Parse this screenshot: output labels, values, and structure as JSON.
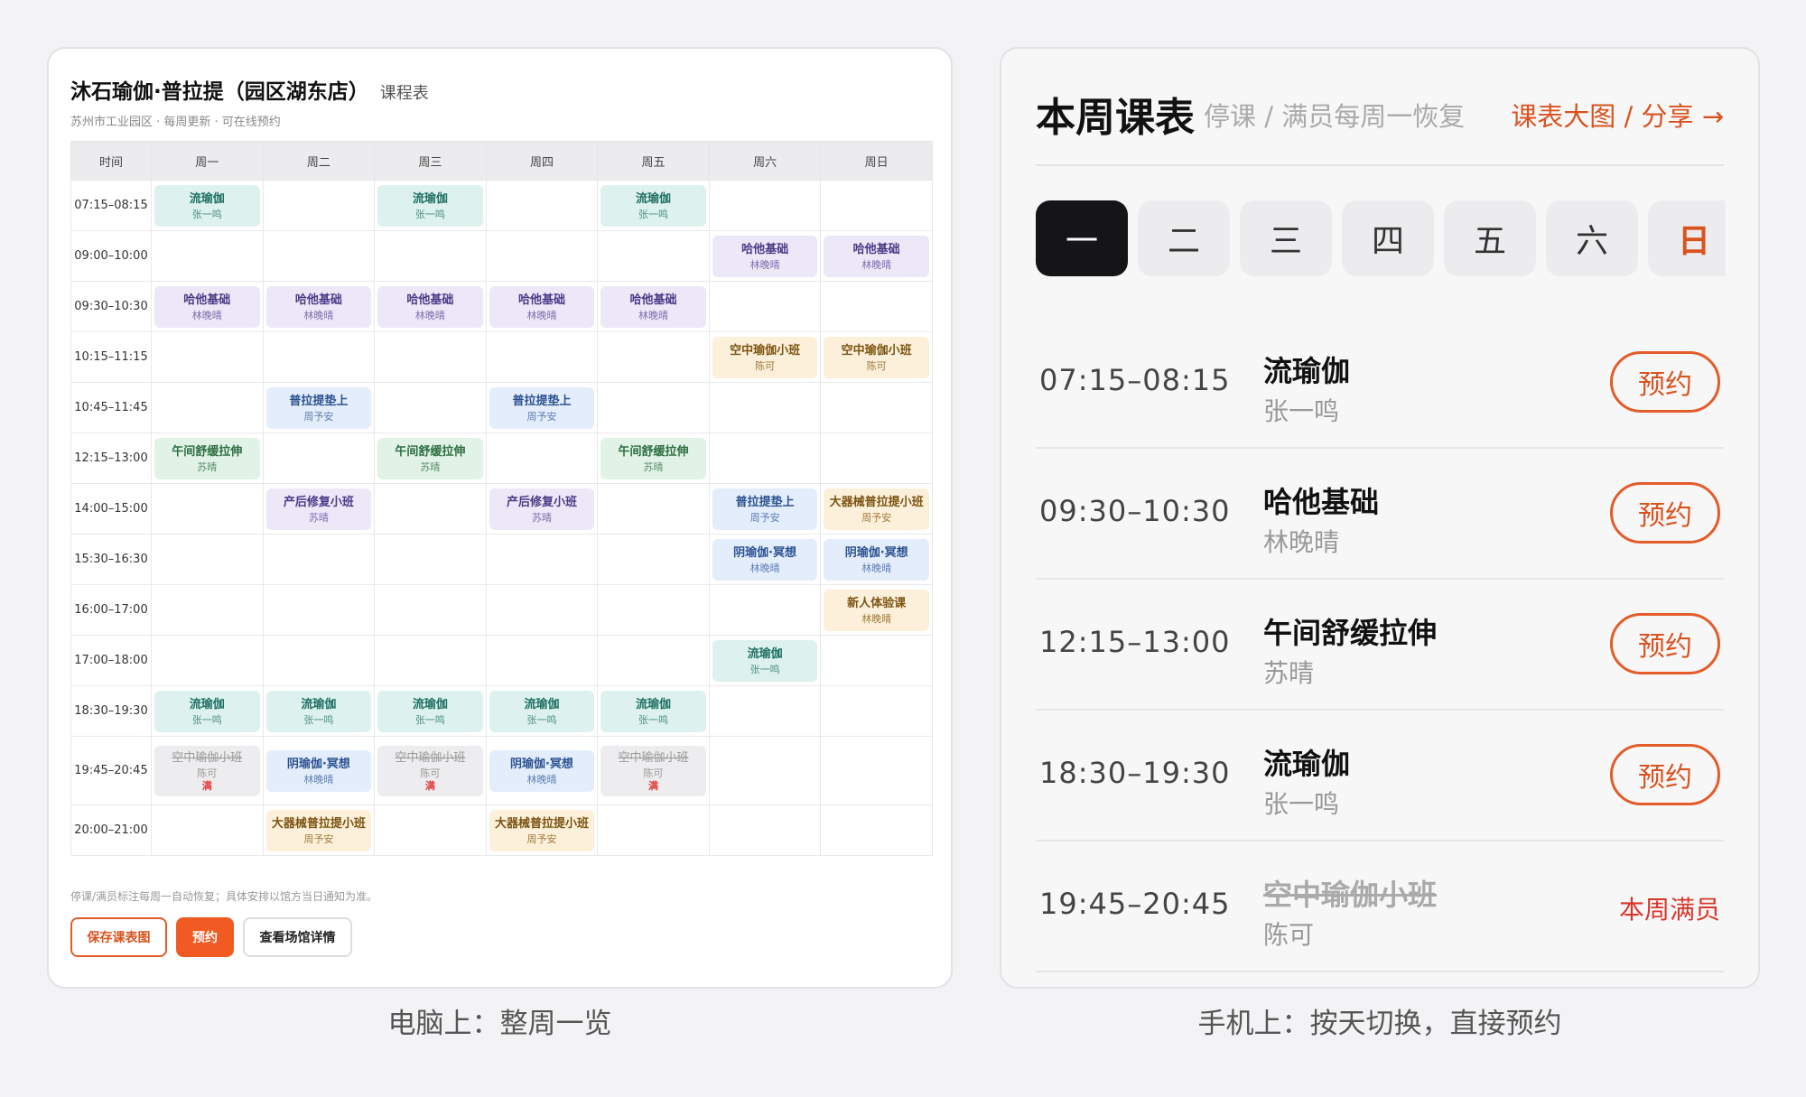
{
  "desktop": {
    "title": "沐石瑜伽·普拉提（园区湖东店）",
    "title_suffix": "课程表",
    "subtitle": "苏州市工业园区 · 每周更新 · 可在线预约",
    "headers": [
      "时间",
      "周一",
      "周二",
      "周三",
      "周四",
      "周五",
      "周六",
      "周日"
    ],
    "rows": [
      {
        "time": "07:15–08:15",
        "cells": [
          {
            "name": "流瑜伽",
            "teacher": "张一鸣",
            "color": "teal"
          },
          null,
          {
            "name": "流瑜伽",
            "teacher": "张一鸣",
            "color": "teal"
          },
          null,
          {
            "name": "流瑜伽",
            "teacher": "张一鸣",
            "color": "teal"
          },
          null,
          null
        ]
      },
      {
        "time": "09:00–10:00",
        "cells": [
          null,
          null,
          null,
          null,
          null,
          {
            "name": "哈他基础",
            "teacher": "林晚晴",
            "color": "lav"
          },
          {
            "name": "哈他基础",
            "teacher": "林晚晴",
            "color": "lav"
          }
        ]
      },
      {
        "time": "09:30–10:30",
        "cells": [
          {
            "name": "哈他基础",
            "teacher": "林晚晴",
            "color": "lav"
          },
          {
            "name": "哈他基础",
            "teacher": "林晚晴",
            "color": "lav"
          },
          {
            "name": "哈他基础",
            "teacher": "林晚晴",
            "color": "lav"
          },
          {
            "name": "哈他基础",
            "teacher": "林晚晴",
            "color": "lav"
          },
          {
            "name": "哈他基础",
            "teacher": "林晚晴",
            "color": "lav"
          },
          null,
          null
        ]
      },
      {
        "time": "10:15–11:15",
        "cells": [
          null,
          null,
          null,
          null,
          null,
          {
            "name": "空中瑜伽小班",
            "teacher": "陈可",
            "color": "amber"
          },
          {
            "name": "空中瑜伽小班",
            "teacher": "陈可",
            "color": "amber"
          }
        ]
      },
      {
        "time": "10:45–11:45",
        "cells": [
          null,
          {
            "name": "普拉提垫上",
            "teacher": "周予安",
            "color": "blue"
          },
          null,
          {
            "name": "普拉提垫上",
            "teacher": "周予安",
            "color": "blue"
          },
          null,
          null,
          null
        ]
      },
      {
        "time": "12:15–13:00",
        "cells": [
          {
            "name": "午间舒缓拉伸",
            "teacher": "苏晴",
            "color": "green"
          },
          null,
          {
            "name": "午间舒缓拉伸",
            "teacher": "苏晴",
            "color": "green"
          },
          null,
          {
            "name": "午间舒缓拉伸",
            "teacher": "苏晴",
            "color": "green"
          },
          null,
          null
        ]
      },
      {
        "time": "14:00–15:00",
        "cells": [
          null,
          {
            "name": "产后修复小班",
            "teacher": "苏晴",
            "color": "lav"
          },
          null,
          {
            "name": "产后修复小班",
            "teacher": "苏晴",
            "color": "lav"
          },
          null,
          {
            "name": "普拉提垫上",
            "teacher": "周予安",
            "color": "blue"
          },
          {
            "name": "大器械普拉提小班",
            "teacher": "周予安",
            "color": "amber"
          }
        ]
      },
      {
        "time": "15:30–16:30",
        "cells": [
          null,
          null,
          null,
          null,
          null,
          {
            "name": "阴瑜伽·冥想",
            "teacher": "林晚晴",
            "color": "blue"
          },
          {
            "name": "阴瑜伽·冥想",
            "teacher": "林晚晴",
            "color": "blue"
          }
        ]
      },
      {
        "time": "16:00–17:00",
        "cells": [
          null,
          null,
          null,
          null,
          null,
          null,
          {
            "name": "新人体验课",
            "teacher": "林晚晴",
            "color": "amber"
          }
        ]
      },
      {
        "time": "17:00–18:00",
        "cells": [
          null,
          null,
          null,
          null,
          null,
          {
            "name": "流瑜伽",
            "teacher": "张一鸣",
            "color": "teal"
          },
          null
        ]
      },
      {
        "time": "18:30–19:30",
        "cells": [
          {
            "name": "流瑜伽",
            "teacher": "张一鸣",
            "color": "teal"
          },
          {
            "name": "流瑜伽",
            "teacher": "张一鸣",
            "color": "teal"
          },
          {
            "name": "流瑜伽",
            "teacher": "张一鸣",
            "color": "teal"
          },
          {
            "name": "流瑜伽",
            "teacher": "张一鸣",
            "color": "teal"
          },
          {
            "name": "流瑜伽",
            "teacher": "张一鸣",
            "color": "teal"
          },
          null,
          null
        ]
      },
      {
        "time": "19:45–20:45",
        "tall": true,
        "cells": [
          {
            "name": "空中瑜伽小班",
            "teacher": "陈可",
            "color": "gray",
            "full": "满"
          },
          {
            "name": "阴瑜伽·冥想",
            "teacher": "林晚晴",
            "color": "blue"
          },
          {
            "name": "空中瑜伽小班",
            "teacher": "陈可",
            "color": "gray",
            "full": "满"
          },
          {
            "name": "阴瑜伽·冥想",
            "teacher": "林晚晴",
            "color": "blue"
          },
          {
            "name": "空中瑜伽小班",
            "teacher": "陈可",
            "color": "gray",
            "full": "满"
          },
          null,
          null
        ]
      },
      {
        "time": "20:00–21:00",
        "cells": [
          null,
          {
            "name": "大器械普拉提小班",
            "teacher": "周予安",
            "color": "amber"
          },
          null,
          {
            "name": "大器械普拉提小班",
            "teacher": "周予安",
            "color": "amber"
          },
          null,
          null,
          null
        ]
      }
    ],
    "note": "停课/满员标注每周一自动恢复；具体安排以馆方当日通知为准。",
    "buttons": {
      "save": "保存课表图",
      "book": "预约",
      "venue": "查看场馆详情"
    },
    "caption": "电脑上：整周一览"
  },
  "mobile": {
    "title": "本周课表",
    "subtitle": "停课 / 满员每周一恢复",
    "link": "课表大图 / 分享 →",
    "days": [
      "一",
      "二",
      "三",
      "四",
      "五",
      "六",
      "日"
    ],
    "active_day": 0,
    "classes": [
      {
        "time": "07:15–08:15",
        "name": "流瑜伽",
        "teacher": "张一鸣",
        "action": "预约"
      },
      {
        "time": "09:30–10:30",
        "name": "哈他基础",
        "teacher": "林晚晴",
        "action": "预约"
      },
      {
        "time": "12:15–13:00",
        "name": "午间舒缓拉伸",
        "teacher": "苏晴",
        "action": "预约"
      },
      {
        "time": "18:30–19:30",
        "name": "流瑜伽",
        "teacher": "张一鸣",
        "action": "预约"
      },
      {
        "time": "19:45–20:45",
        "name": "空中瑜伽小班",
        "teacher": "陈可",
        "full_note": "本周满员"
      }
    ],
    "caption": "手机上：按天切换，直接预约"
  },
  "colors": {
    "accent": "#f15a22",
    "accent_text": "#d9531f",
    "full": "#d9362b",
    "active_tab": "#151518"
  }
}
